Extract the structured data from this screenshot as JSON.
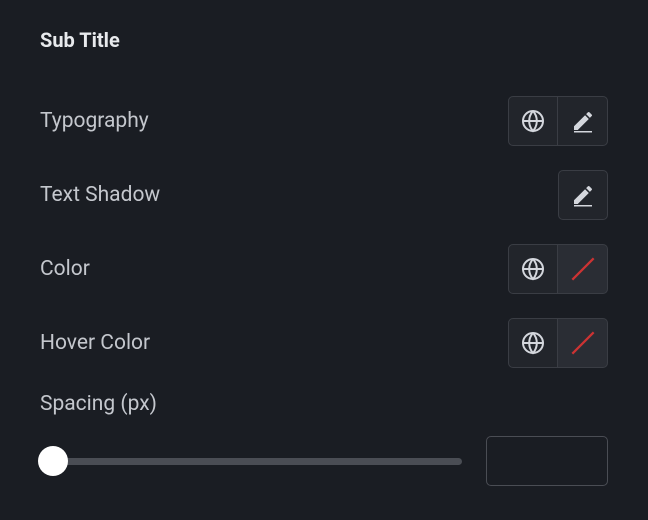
{
  "section": {
    "title": "Sub Title"
  },
  "rows": {
    "typography": {
      "label": "Typography"
    },
    "textshadow": {
      "label": "Text Shadow"
    },
    "color": {
      "label": "Color"
    },
    "hovercolor": {
      "label": "Hover Color"
    },
    "spacing": {
      "label": "Spacing (px)",
      "value": ""
    }
  }
}
